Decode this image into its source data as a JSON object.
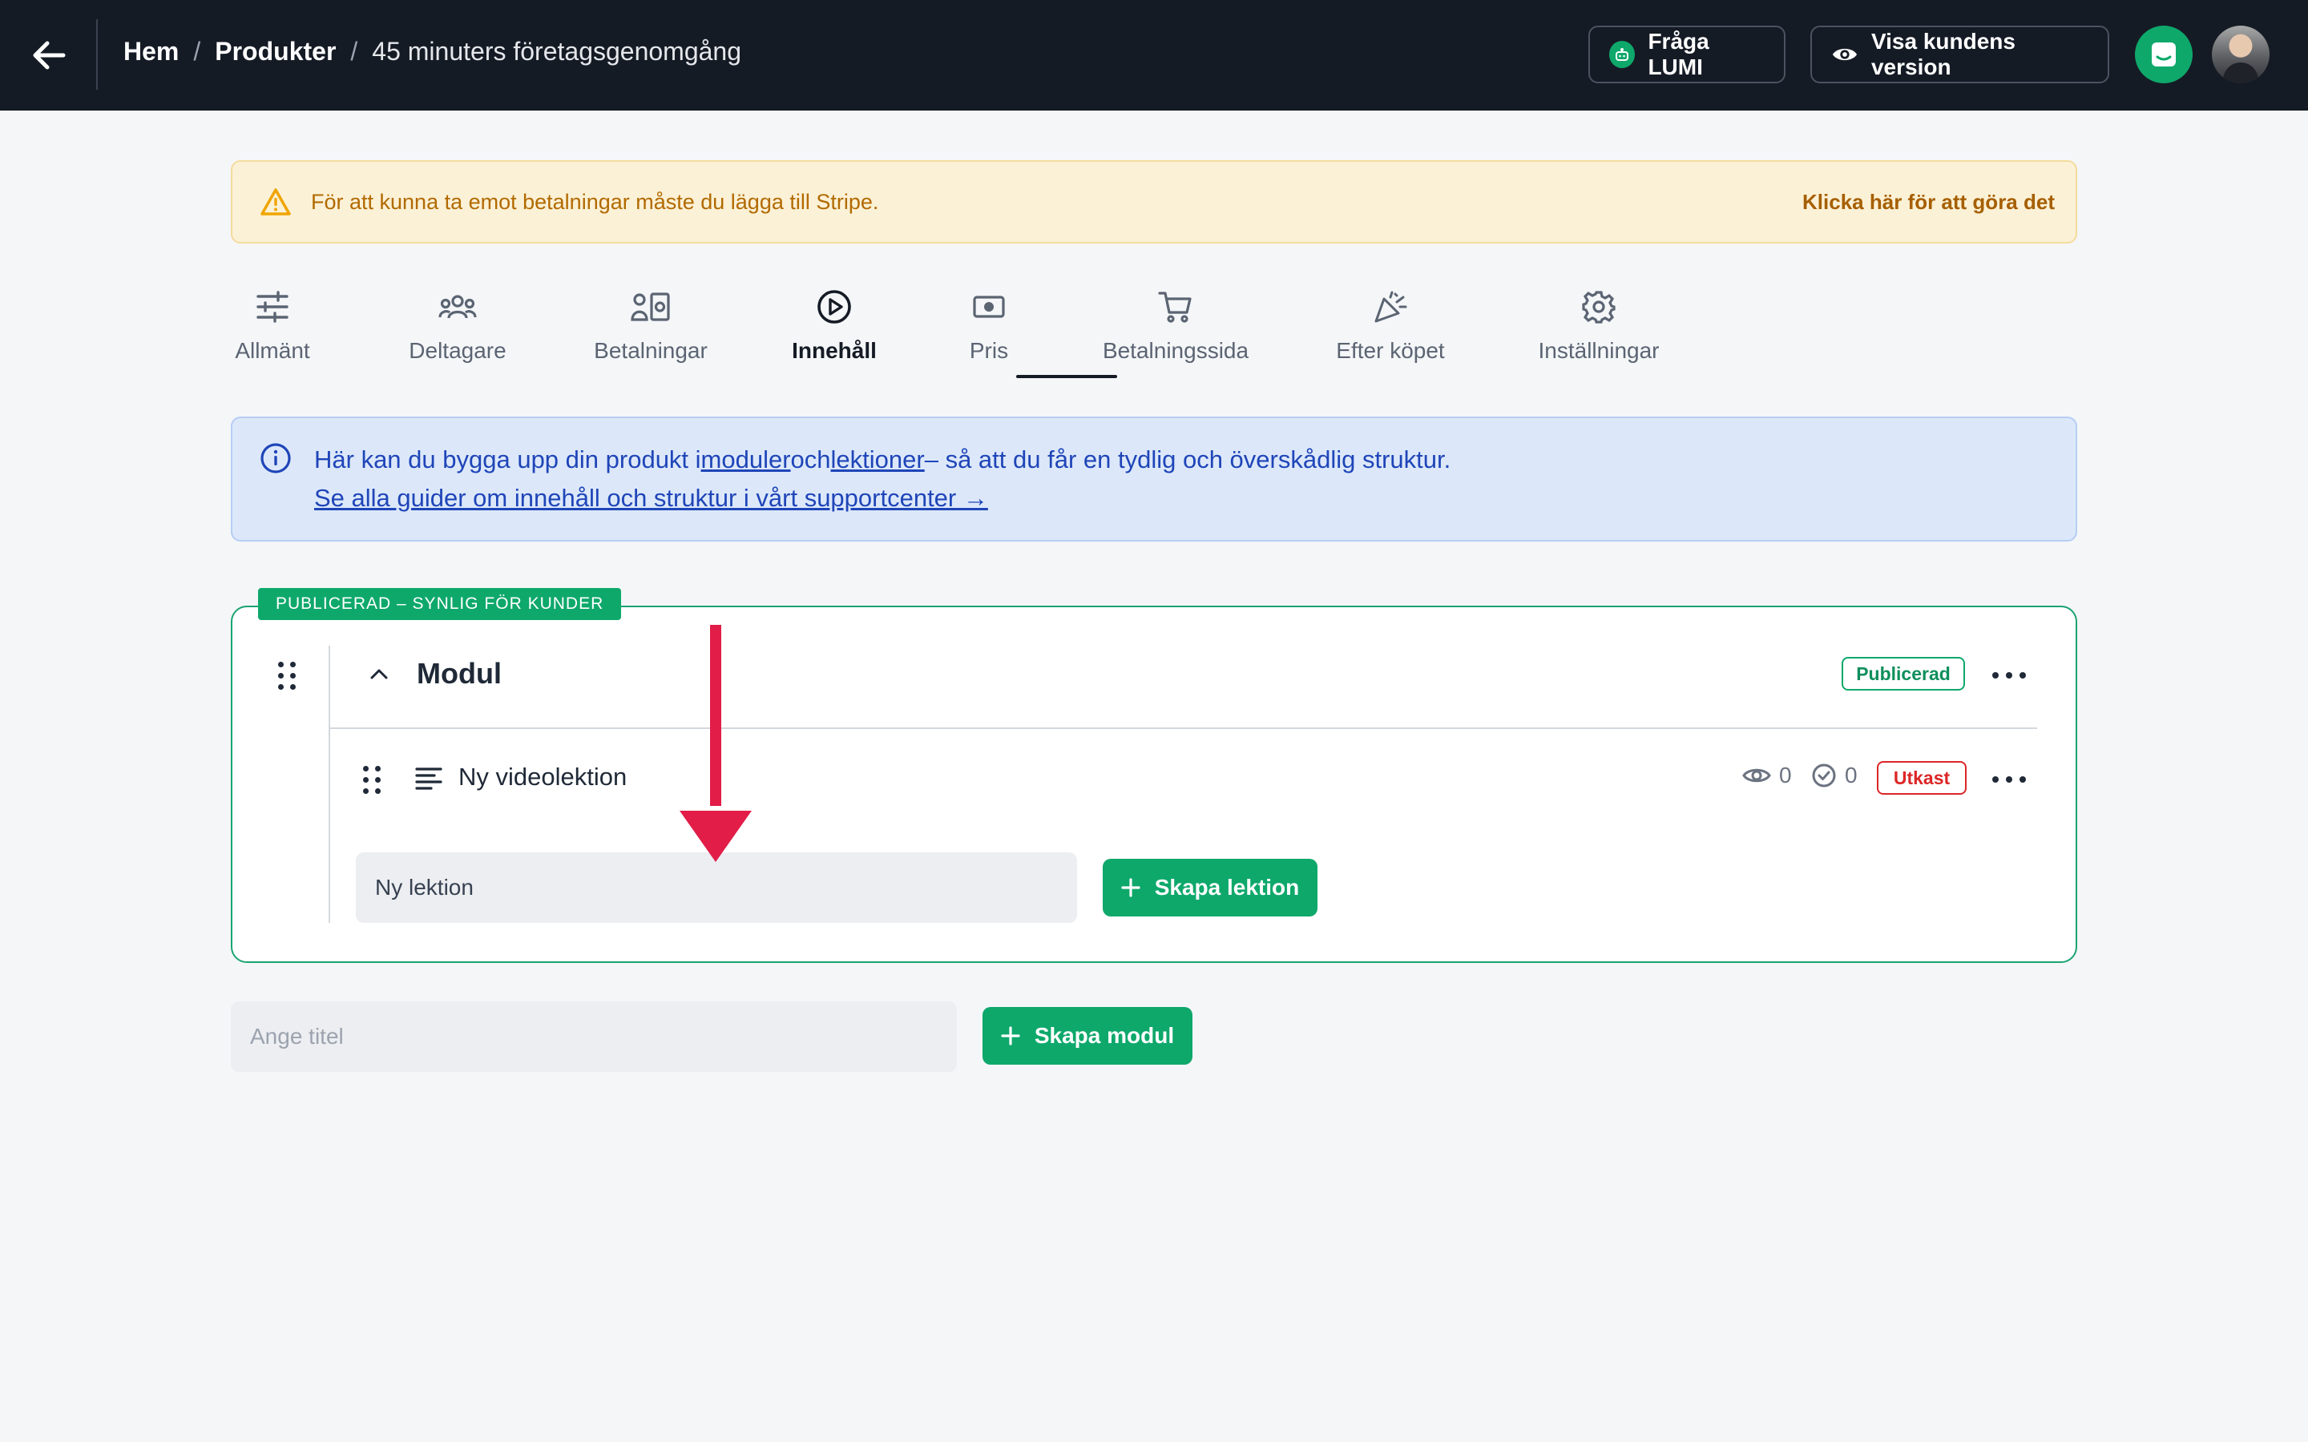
{
  "topbar": {
    "breadcrumb": {
      "home": "Hem",
      "separator": "/",
      "products": "Produkter",
      "current": "45 minuters företagsgenomgång"
    },
    "ask_lumi_label": "Fråga LUMI",
    "customer_view_label": "Visa kundens version"
  },
  "warning": {
    "text": "För att kunna ta emot betalningar måste du lägga till Stripe.",
    "link": "Klicka här för att göra det"
  },
  "tabs": [
    {
      "label": "Allmänt",
      "icon": "sliders-icon"
    },
    {
      "label": "Deltagare",
      "icon": "users-icon"
    },
    {
      "label": "Betalningar",
      "icon": "payments-icon"
    },
    {
      "label": "Innehåll",
      "icon": "play-circle-icon",
      "active": true
    },
    {
      "label": "Pris",
      "icon": "money-icon"
    },
    {
      "label": "Betalningssida",
      "icon": "cart-icon"
    },
    {
      "label": "Efter köpet",
      "icon": "party-popper-icon"
    },
    {
      "label": "Inställningar",
      "icon": "gear-icon"
    }
  ],
  "info": {
    "line1_before": "Här kan du bygga upp din produkt i",
    "link_modules": "moduler",
    "and": "och",
    "link_lessons": "lektioner",
    "line1_after": "– så att du får en tydlig och överskådlig struktur.",
    "guide_link": "Se alla guider om innehåll och struktur i vårt supportcenter →"
  },
  "module": {
    "section_badge": "PUBLICERAD – SYNLIG FÖR KUNDER",
    "title": "Modul",
    "status": "Publicerad",
    "lessons": [
      {
        "title": "Ny videolektion",
        "views": "0",
        "completed": "0",
        "status": "Utkast"
      }
    ],
    "new_lesson_value": "Ny lektion",
    "create_lesson_label": "Skapa lektion"
  },
  "new_module": {
    "placeholder": "Ange titel",
    "create_label": "Skapa modul"
  },
  "colors": {
    "topbar": "#151b25",
    "accent_green": "#0ea86b",
    "warning_bg": "#fbf1d6",
    "info_bg": "#dce8fa",
    "draft_red": "#dc2626",
    "annotation_arrow": "#e11d48"
  }
}
